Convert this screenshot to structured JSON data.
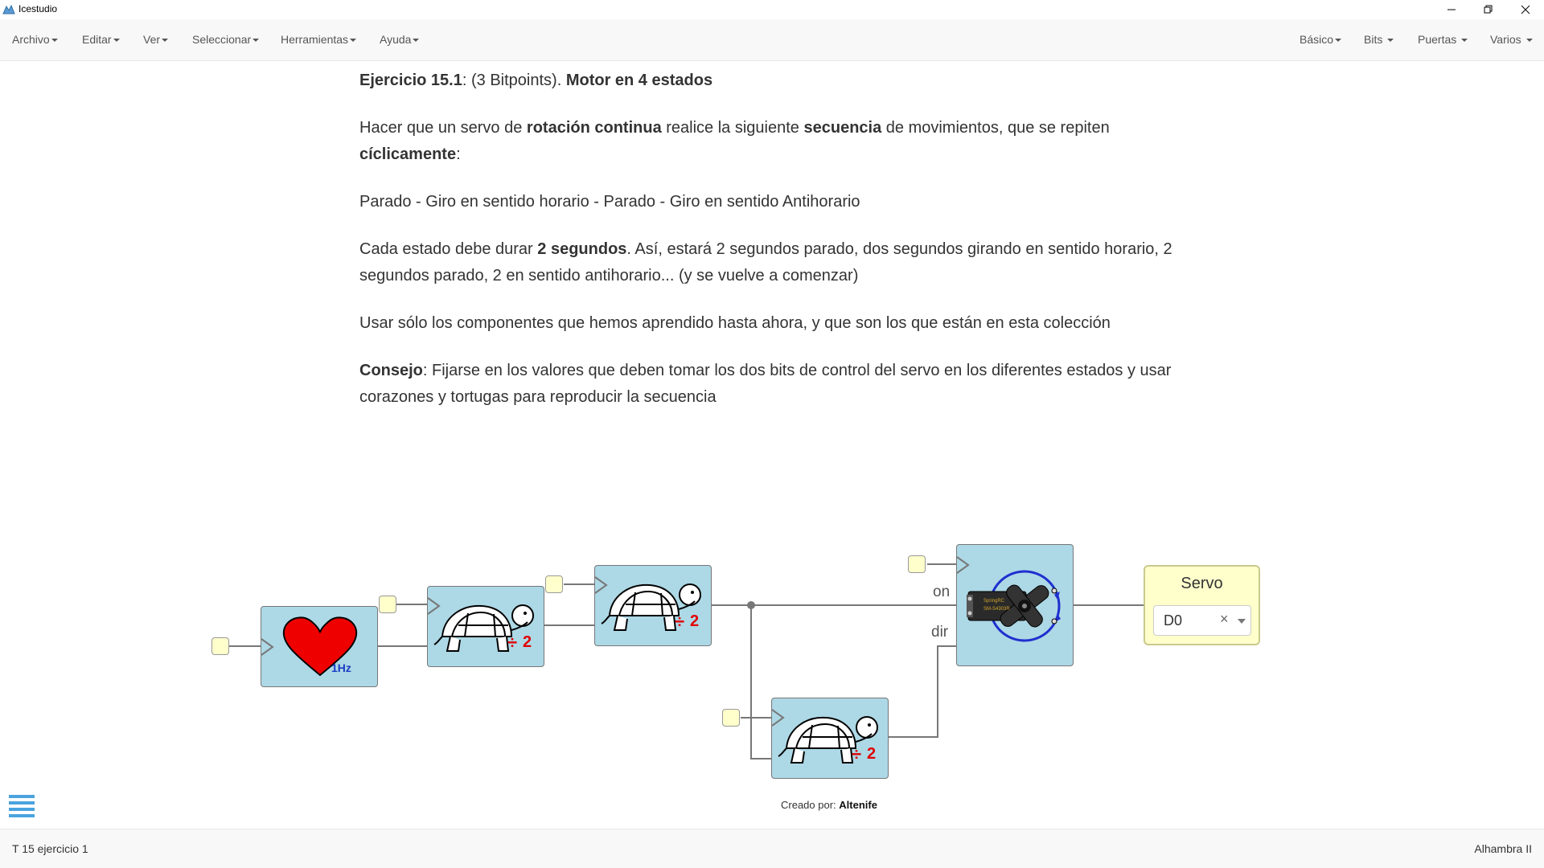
{
  "window": {
    "title": "Icestudio"
  },
  "menubar": {
    "left": [
      {
        "label": "Archivo"
      },
      {
        "label": "Editar"
      },
      {
        "label": "Ver"
      },
      {
        "label": "Seleccionar"
      },
      {
        "label": "Herramientas"
      },
      {
        "label": "Ayuda"
      }
    ],
    "right": [
      {
        "label": "Básico"
      },
      {
        "label": "Bits"
      },
      {
        "label": "Puertas"
      },
      {
        "label": "Varios"
      }
    ]
  },
  "info": {
    "p1": {
      "ex_label": "Ejercicio 15.1",
      "points": ": (3 Bitpoints). ",
      "title": "Motor en 4 estados"
    },
    "p2": {
      "t1": "Hacer que un servo de ",
      "b1": "rotación continua",
      "t2": " realice la siguiente ",
      "b2": "secuencia",
      "t3": " de movimientos, que se repiten ",
      "b3": "cíclicamente",
      "t4": ":"
    },
    "p3": "Parado - Giro en sentido horario - Parado - Giro en sentido Antihorario",
    "p4": {
      "t1": "Cada estado debe durar ",
      "b1": "2 segundos",
      "t2": ". Así, estará 2 segundos parado, dos segundos girando en sentido horario, 2 segundos parado, 2 en sentido antihorario... (y se vuelve a comenzar)"
    },
    "p5": "Usar sólo los componentes que hemos aprendido hasta ahora, y que son los que están en esta colección",
    "p6": {
      "b1": "Consejo",
      "t1": ": Fijarse en los valores que deben tomar los dos bits de control del servo en los diferentes estados y usar corazones y tortugas para reproducir la secuencia"
    }
  },
  "diagram": {
    "heart": {
      "freq_label": "1Hz"
    },
    "prescaler_label": "2",
    "servo_ports": {
      "on": "on",
      "dir": "dir"
    },
    "servo_chip": {
      "line1": "SpringRC",
      "line2": "SM-S4303R"
    },
    "servo_output": {
      "title": "Servo",
      "pin": "D0",
      "clear": "×"
    }
  },
  "credit": {
    "prefix": "Creado por: ",
    "author": "Altenife"
  },
  "footer": {
    "file": "T 15 ejercicio 1",
    "board": "Alhambra II"
  },
  "colors": {
    "block": "#add8e6",
    "port": "#ffffcc",
    "heart": "#ee0000",
    "accent": "#4aa3df"
  }
}
